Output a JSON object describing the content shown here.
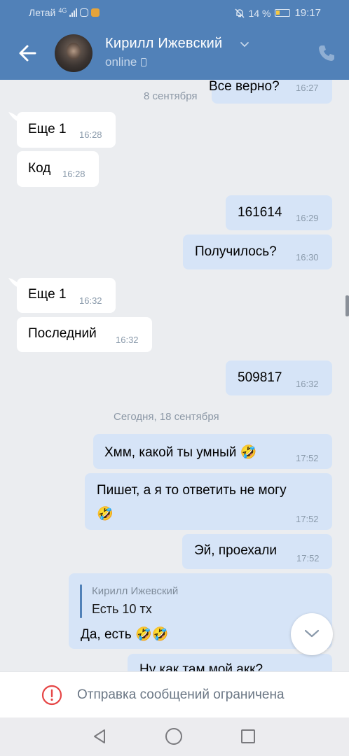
{
  "status_bar": {
    "carrier": "Летай",
    "network": "4G",
    "battery": "14 %",
    "time": "19:17"
  },
  "header": {
    "contact_name": "Кирилл Ижевский",
    "status": "online",
    "colors": {
      "bar": "#5181b8"
    }
  },
  "chat": {
    "messages": [
      {
        "side": "out",
        "text": "Все верно?",
        "time": "16:27"
      },
      {
        "side": "in",
        "text": "Еще 1",
        "time": "16:28"
      },
      {
        "side": "in",
        "text": "Код",
        "time": "16:28"
      },
      {
        "side": "out",
        "text": "161614",
        "time": "16:29"
      },
      {
        "side": "out",
        "text": "Получилось?",
        "time": "16:30"
      },
      {
        "side": "in",
        "text": "Еще 1",
        "time": "16:32"
      },
      {
        "side": "in",
        "text": "Последний",
        "time": "16:32"
      },
      {
        "side": "out",
        "text": "509817",
        "time": "16:32"
      },
      {
        "side": "out",
        "text": "Хмм, какой ты умный 🤣",
        "time": "17:52"
      },
      {
        "side": "out",
        "text": "Пишет, а я то ответить не могу",
        "text2": "🤣",
        "time": "17:52"
      },
      {
        "side": "out",
        "text": "Эй, проехали",
        "time": "17:52"
      },
      {
        "side": "out",
        "reply_author": "Кирилл Ижевский",
        "reply_text": "Есть 10 тх",
        "text": "Да, есть 🤣🤣"
      },
      {
        "side": "out",
        "text": "Ну как там мой акк?"
      }
    ],
    "date_separators": [
      "8 сентября",
      "Сегодня, 18 сентября"
    ],
    "colors": {
      "incoming": "#ffffff",
      "outgoing": "#d6e4f7",
      "background": "#ebedf0"
    }
  },
  "restriction": {
    "text": "Отправка сообщений ограничена",
    "icon": "warning-circle-icon",
    "color": "#e64646"
  },
  "nav": {
    "icons": [
      "back-triangle-icon",
      "home-circle-icon",
      "recents-square-icon"
    ]
  }
}
